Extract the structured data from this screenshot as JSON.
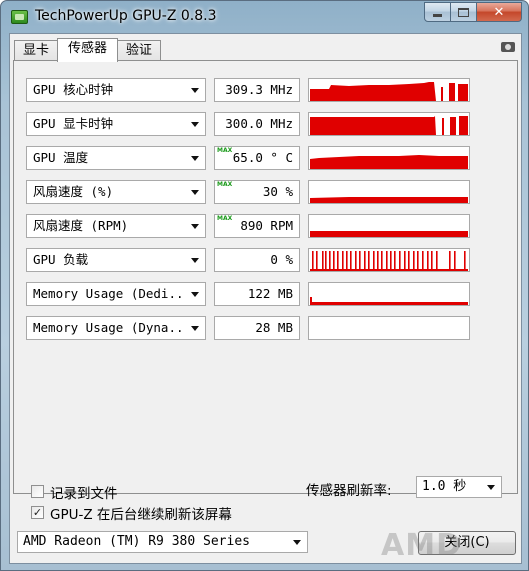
{
  "window": {
    "title": "TechPowerUp GPU-Z 0.8.3",
    "minimize_label": "",
    "maximize_label": "",
    "close_label": "✕"
  },
  "tabs": [
    {
      "label": "显卡"
    },
    {
      "label": "传感器"
    },
    {
      "label": "验证"
    }
  ],
  "active_tab": "传感器",
  "sensors": [
    {
      "label": "GPU 核心时钟",
      "value": "309.3 MHz",
      "max": false
    },
    {
      "label": "GPU 显卡时钟",
      "value": "300.0 MHz",
      "max": false
    },
    {
      "label": "GPU 温度",
      "value": "65.0 ° C",
      "max": true,
      "max_tag": "MAX"
    },
    {
      "label": "风扇速度 (%)",
      "value": "30 %",
      "max": true,
      "max_tag": "MAX"
    },
    {
      "label": "风扇速度 (RPM)",
      "value": "890 RPM",
      "max": true,
      "max_tag": "MAX"
    },
    {
      "label": "GPU 负载",
      "value": "0 %",
      "max": false
    },
    {
      "label": "Memory Usage (Dedi..",
      "value": "122 MB",
      "max": false
    },
    {
      "label": "Memory Usage (Dyna..",
      "value": "28 MB",
      "max": false
    }
  ],
  "graph_color": "#e00000",
  "options": {
    "log_to_file": {
      "label": "记录到文件",
      "checked": false
    },
    "keep_refresh": {
      "label": "GPU-Z 在后台继续刷新该屏幕",
      "checked": true
    },
    "refresh_rate_label": "传感器刷新率:",
    "refresh_rate_value": "1.0 秒"
  },
  "footer": {
    "gpu_select": "AMD Radeon (TM) R9 380 Series",
    "close_button": "关闭(C)",
    "logo_text": "AMD"
  }
}
